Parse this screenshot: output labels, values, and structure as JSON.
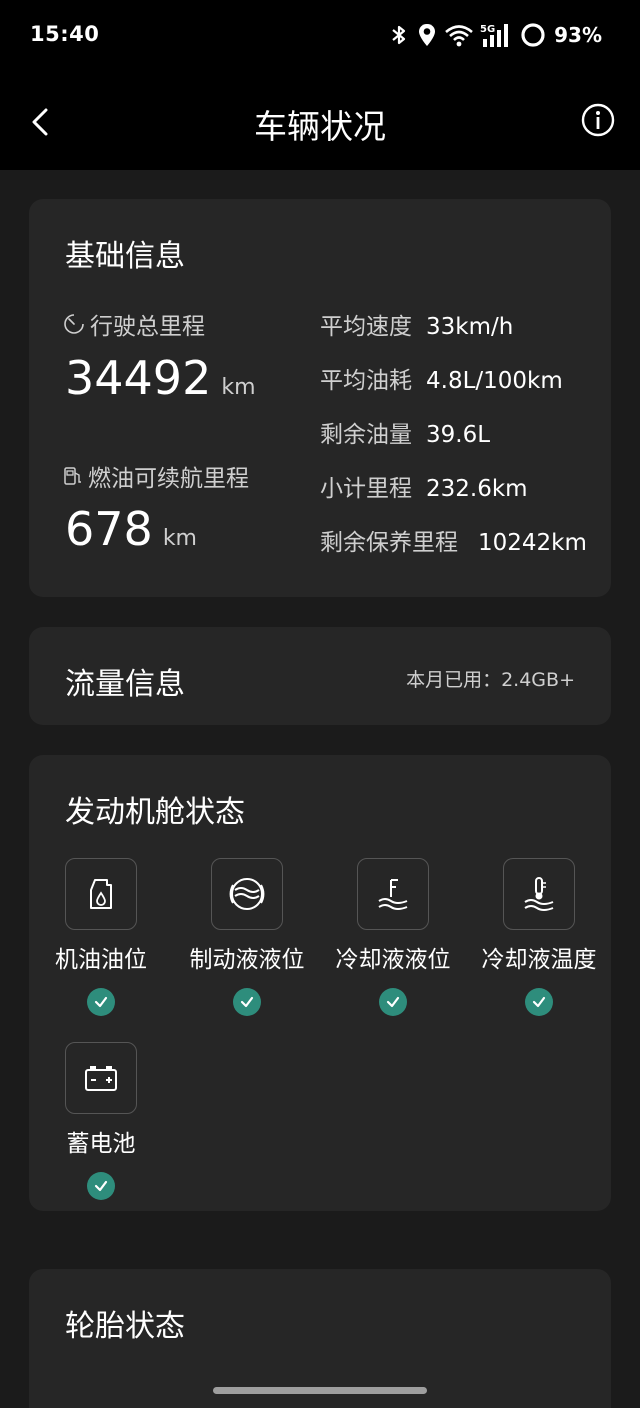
{
  "status_bar": {
    "time": "15:40",
    "battery_percent": "93%",
    "network": "5G"
  },
  "app_bar": {
    "title": "车辆状况"
  },
  "basic_info": {
    "title": "基础信息",
    "total_mileage_label": "行驶总里程",
    "total_mileage_value": "34492",
    "total_mileage_unit": "km",
    "range_label": "燃油可续航里程",
    "range_value": "678",
    "range_unit": "km",
    "stats": [
      {
        "label": "平均速度",
        "value": "33km/h"
      },
      {
        "label": "平均油耗",
        "value": "4.8L/100km"
      },
      {
        "label": "剩余油量",
        "value": "39.6L"
      },
      {
        "label": "小计里程",
        "value": "232.6km"
      },
      {
        "label": "剩余保养里程",
        "value": "10242km"
      }
    ]
  },
  "traffic_info": {
    "title": "流量信息",
    "usage": "本月已用：2.4GB+"
  },
  "engine_status": {
    "title": "发动机舱状态",
    "items": [
      {
        "label": "机油油位",
        "icon": "oil-can-icon",
        "status": "ok"
      },
      {
        "label": "制动液液位",
        "icon": "brake-fluid-icon",
        "status": "ok"
      },
      {
        "label": "冷却液液位",
        "icon": "coolant-level-icon",
        "status": "ok"
      },
      {
        "label": "冷却液温度",
        "icon": "coolant-temp-icon",
        "status": "ok"
      },
      {
        "label": "蓄电池",
        "icon": "battery-icon",
        "status": "ok"
      }
    ]
  },
  "tire_status": {
    "title": "轮胎状态"
  },
  "colors": {
    "background": "#1b1b1b",
    "card": "#262626",
    "bar": "#000000",
    "check": "#2e8d7c"
  }
}
